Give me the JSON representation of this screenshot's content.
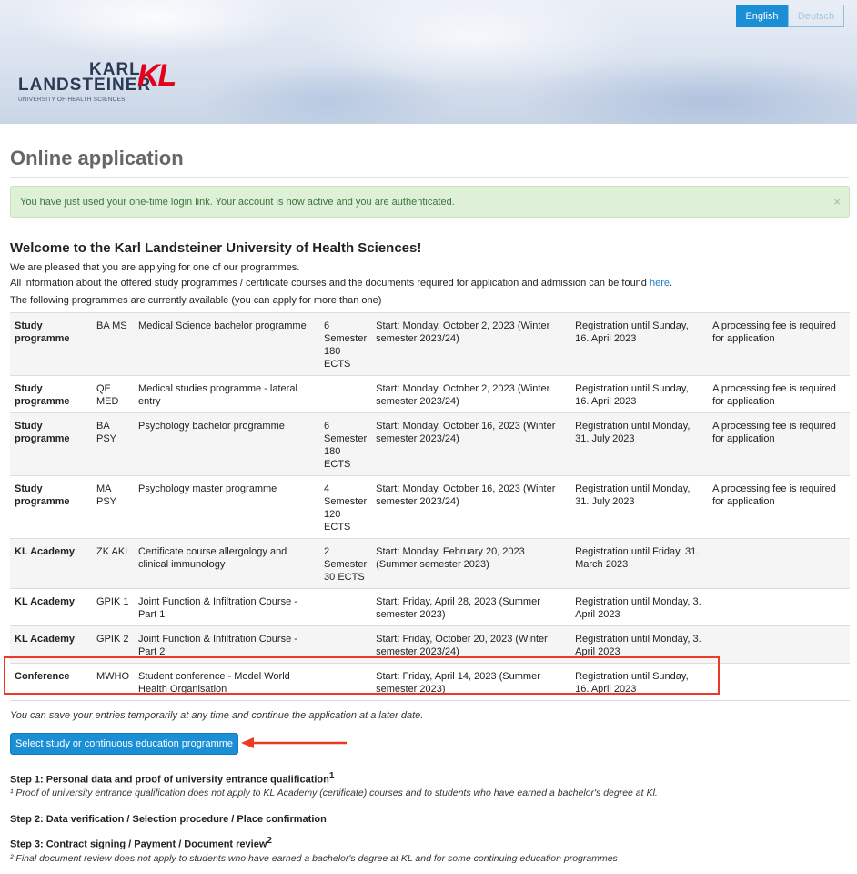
{
  "header": {
    "logo_line1": "KARL",
    "logo_line2": "LANDSTEINER",
    "logo_mark": "KL",
    "logo_sub": "UNIVERSITY OF HEALTH SCIENCES",
    "lang_en": "English",
    "lang_de": "Deutsch"
  },
  "page_title": "Online application",
  "alert": {
    "text": "You have just used your one-time login link. Your account is now active and you are authenticated.",
    "close": "×"
  },
  "welcome": "Welcome to the Karl Landsteiner University of Health Sciences!",
  "intro1": "We are pleased that you are applying for one of our programmes.",
  "intro2": "All information about the offered study programmes / certificate courses and the documents required for application and admission can be found ",
  "intro2_link": "here",
  "intro2_end": ".",
  "intro3": "The following programmes are currently available (you can apply for more than one)",
  "programmes": [
    {
      "type": "Study programme",
      "code": "BA MS",
      "name": "Medical Science bachelor programme",
      "ects": "6 Semester 180 ECTS",
      "start": "Start: Monday, October 2, 2023 (Winter semester 2023/24)",
      "reg": "Registration until Sunday, 16. April 2023",
      "fee": "A processing fee is required for application"
    },
    {
      "type": "Study programme",
      "code": "QE MED",
      "name": "Medical studies programme - lateral entry",
      "ects": "",
      "start": "Start: Monday, October 2, 2023 (Winter semester 2023/24)",
      "reg": "Registration until Sunday, 16. April 2023",
      "fee": "A processing fee is required for application"
    },
    {
      "type": "Study programme",
      "code": "BA PSY",
      "name": "Psychology bachelor programme",
      "ects": "6 Semester 180 ECTS",
      "start": "Start: Monday, October 16, 2023 (Winter semester 2023/24)",
      "reg": "Registration until Monday, 31. July 2023",
      "fee": "A processing fee is required for application"
    },
    {
      "type": "Study programme",
      "code": "MA PSY",
      "name": "Psychology master programme",
      "ects": "4 Semester 120 ECTS",
      "start": "Start: Monday, October 16, 2023 (Winter semester 2023/24)",
      "reg": "Registration until Monday, 31. July 2023",
      "fee": "A processing fee is required for application"
    },
    {
      "type": "KL Academy",
      "code": "ZK AKI",
      "name": "Certificate course allergology and clinical immunology",
      "ects": "2 Semester 30 ECTS",
      "start": "Start: Monday, February 20, 2023 (Summer semester 2023)",
      "reg": "Registration until Friday, 31. March 2023",
      "fee": ""
    },
    {
      "type": "KL Academy",
      "code": "GPIK 1",
      "name": "Joint Function & Infiltration Course - Part 1",
      "ects": "",
      "start": "Start: Friday, April 28, 2023 (Summer semester 2023)",
      "reg": "Registration until Monday, 3. April 2023",
      "fee": ""
    },
    {
      "type": "KL Academy",
      "code": "GPIK 2",
      "name": "Joint Function & Infiltration Course - Part 2",
      "ects": "",
      "start": "Start: Friday, October 20, 2023 (Winter semester 2023/24)",
      "reg": "Registration until Monday, 3. April 2023",
      "fee": ""
    },
    {
      "type": "Conference",
      "code": "MWHO",
      "name": "Student conference - Model World Health Organisation",
      "ects": "",
      "start": "Start: Friday, April 14, 2023 (Summer semester 2023)",
      "reg": "Registration until Sunday, 16. April 2023",
      "fee": ""
    }
  ],
  "save_note": "You can save your entries temporarily at any time and continue the application at a later date.",
  "select_button": "Select study or continuous education programme",
  "step1": "Step 1: Personal data and proof of university entrance qualification",
  "step1_sup": "1",
  "footnote1": "¹ Proof of university entrance qualification does not apply to KL Academy (certificate) courses and to students who have earned a bachelor's degree at Kl.",
  "step2": "Step 2: Data verification / Selection procedure / Place confirmation",
  "step3": "Step 3: Contract signing / Payment / Document review",
  "step3_sup": "2",
  "footnote2": "² Final document review does not apply to students who have earned a bachelor's degree at KL and for some continuing education programmes",
  "colors": {
    "accent": "#1a8fd6",
    "brand_red": "#e2001a",
    "highlight": "#ec3a24",
    "success_bg": "#dff0d8"
  }
}
